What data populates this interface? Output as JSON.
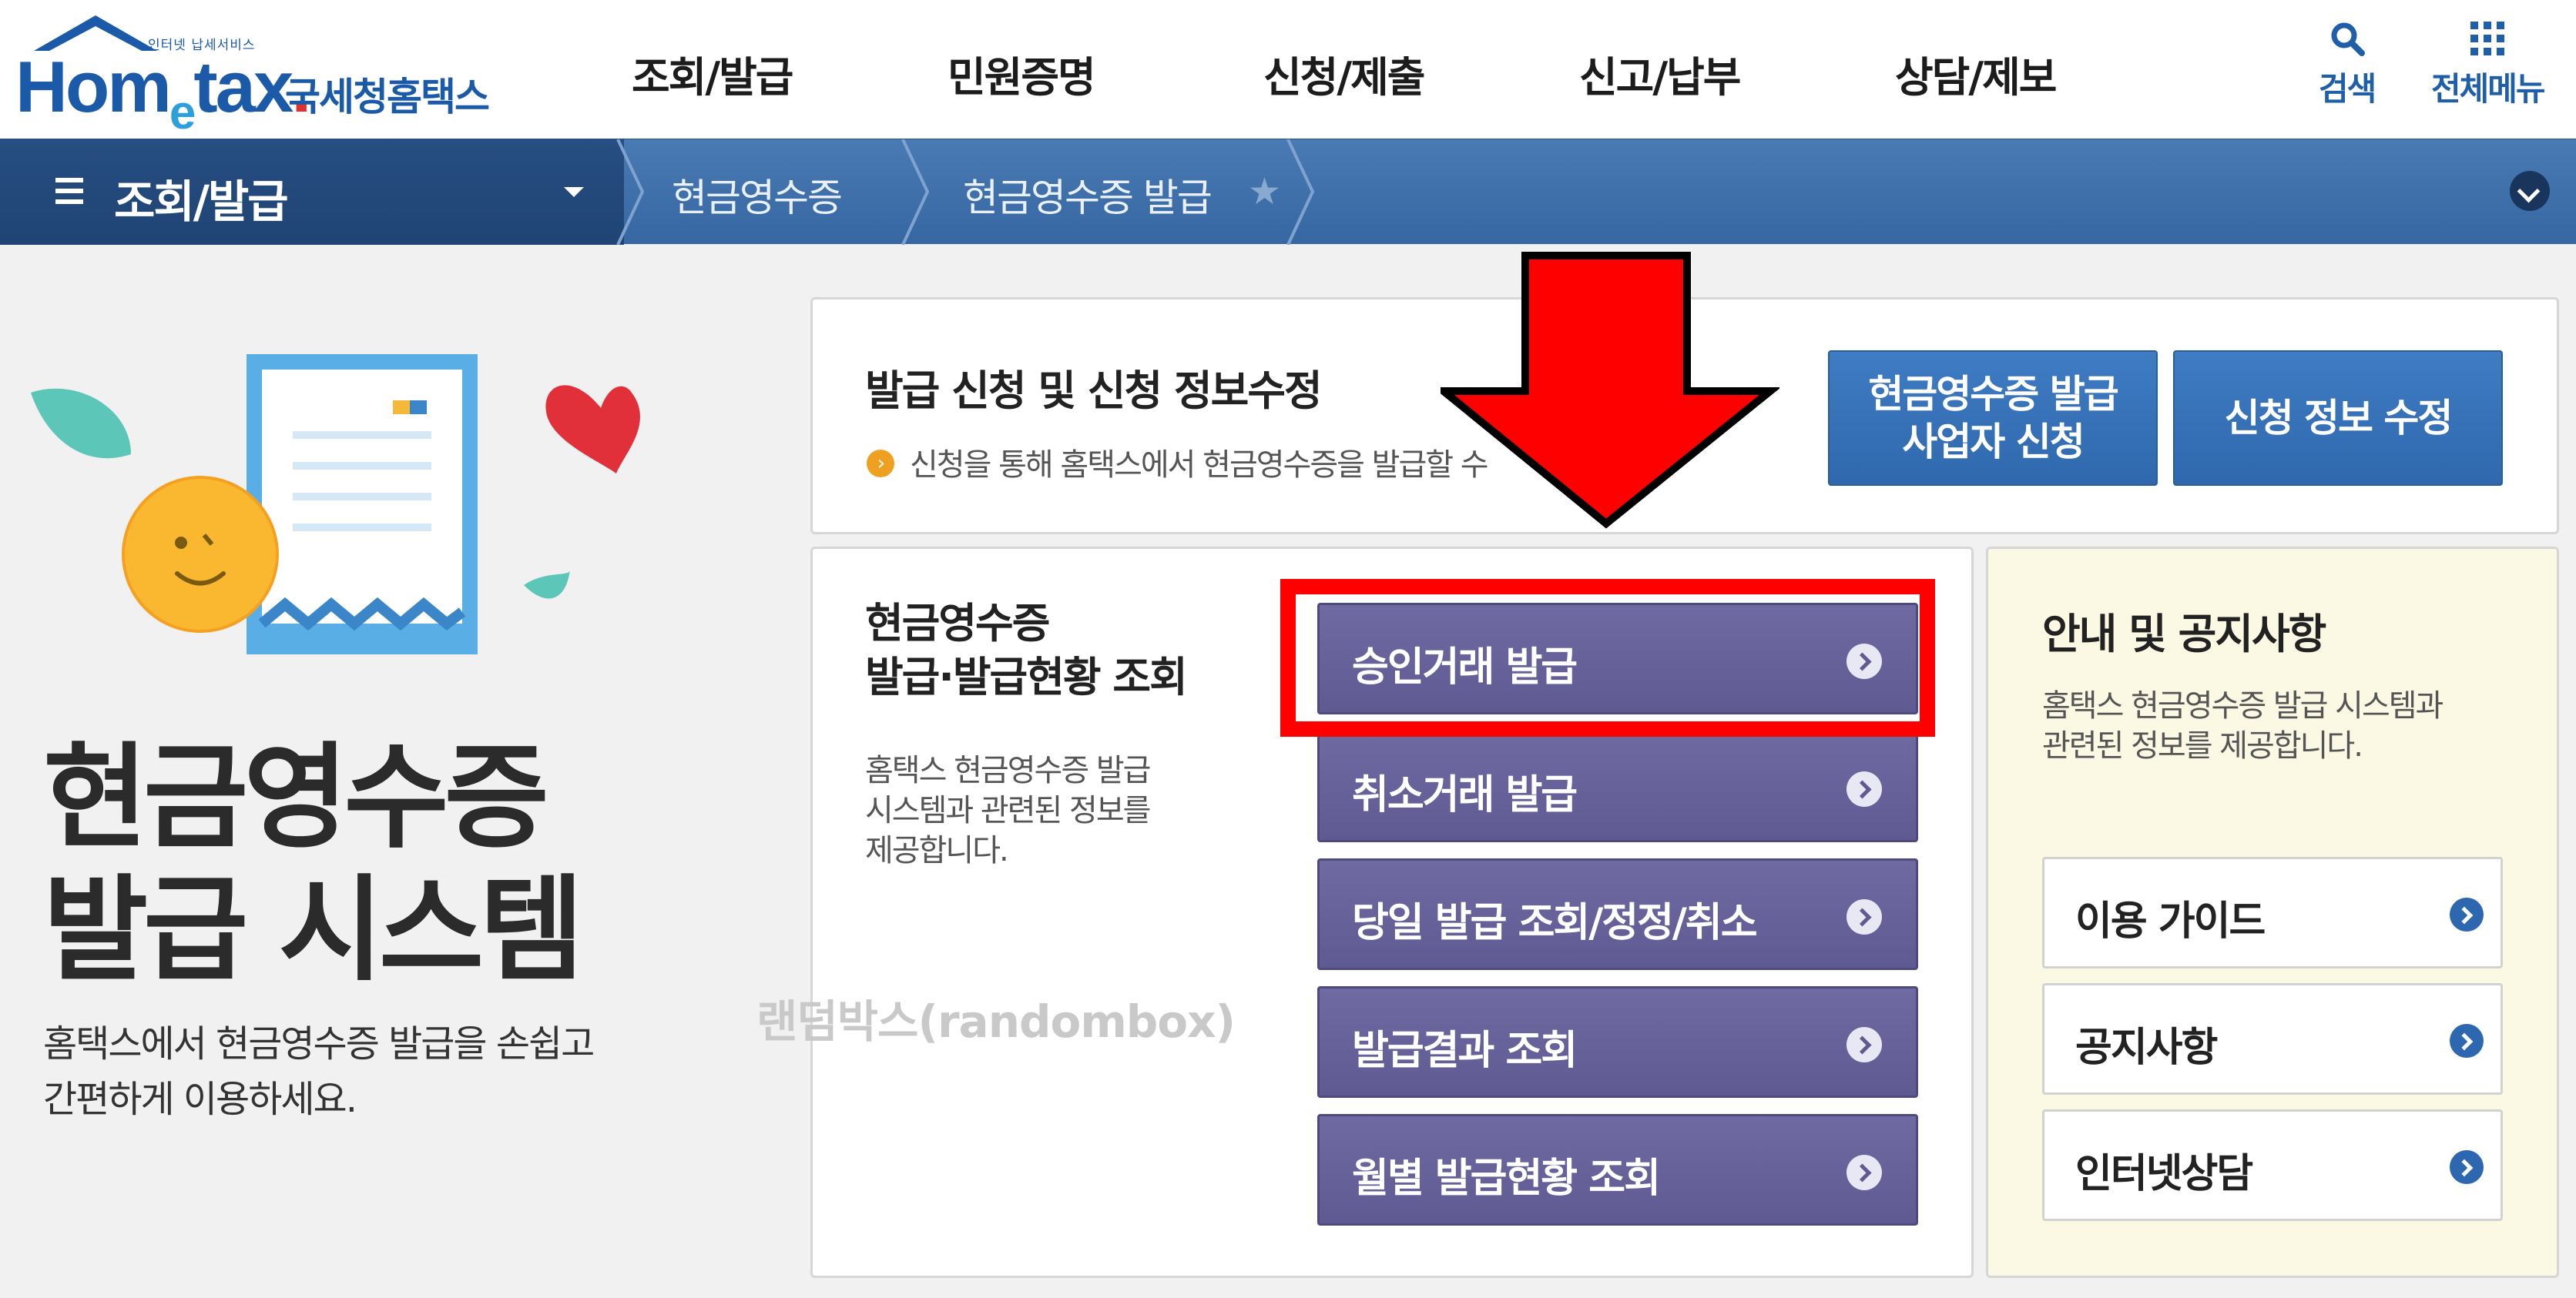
{
  "header": {
    "logo_small": "인터넷 납세서비스",
    "logo_main": "Hometax",
    "logo_sub": "국세청홈택스",
    "nav": [
      "조회/발급",
      "민원증명",
      "신청/제출",
      "신고/납부",
      "상담/제보"
    ],
    "search_label": "검색",
    "all_menu_label": "전체메뉴"
  },
  "breadcrumb": {
    "home": "조회/발급",
    "items": [
      "현금영수증",
      "현금영수증 발급"
    ]
  },
  "hero": {
    "title_line1": "현금영수증",
    "title_line2": "발급 시스템",
    "desc": "홈택스에서 현금영수증 발급을 손쉽고\n간편하게 이용하세요."
  },
  "apply_panel": {
    "title": "발급 신청 및 신청 정보수정",
    "note": "신청을 통해 홈택스에서 현금영수증을 발급할 수",
    "btn_apply": "현금영수증 발급\n사업자 신청",
    "btn_edit": "신청 정보 수정"
  },
  "query_panel": {
    "title": "현금영수증\n발급·발급현황 조회",
    "desc": "홈택스 현금영수증 발급\n시스템과 관련된 정보를\n제공합니다.",
    "buttons": [
      "승인거래 발급",
      "취소거래 발급",
      "당일 발급 조회/정정/취소",
      "발급결과 조회",
      "월별 발급현황 조회"
    ]
  },
  "notice_panel": {
    "title": "안내 및 공지사항",
    "desc": "홈택스 현금영수증 발급 시스템과\n관련된 정보를 제공합니다.",
    "buttons": [
      "이용 가이드",
      "공지사항",
      "인터넷상담"
    ]
  },
  "watermark": "랜덤박스(randombox)",
  "colors": {
    "brand_blue": "#1a5aa8",
    "crumb_bar": "#3667a2",
    "purple_button": "#5f5a92",
    "highlight_red": "#ff0000",
    "notice_bg": "#fbf8e4"
  }
}
